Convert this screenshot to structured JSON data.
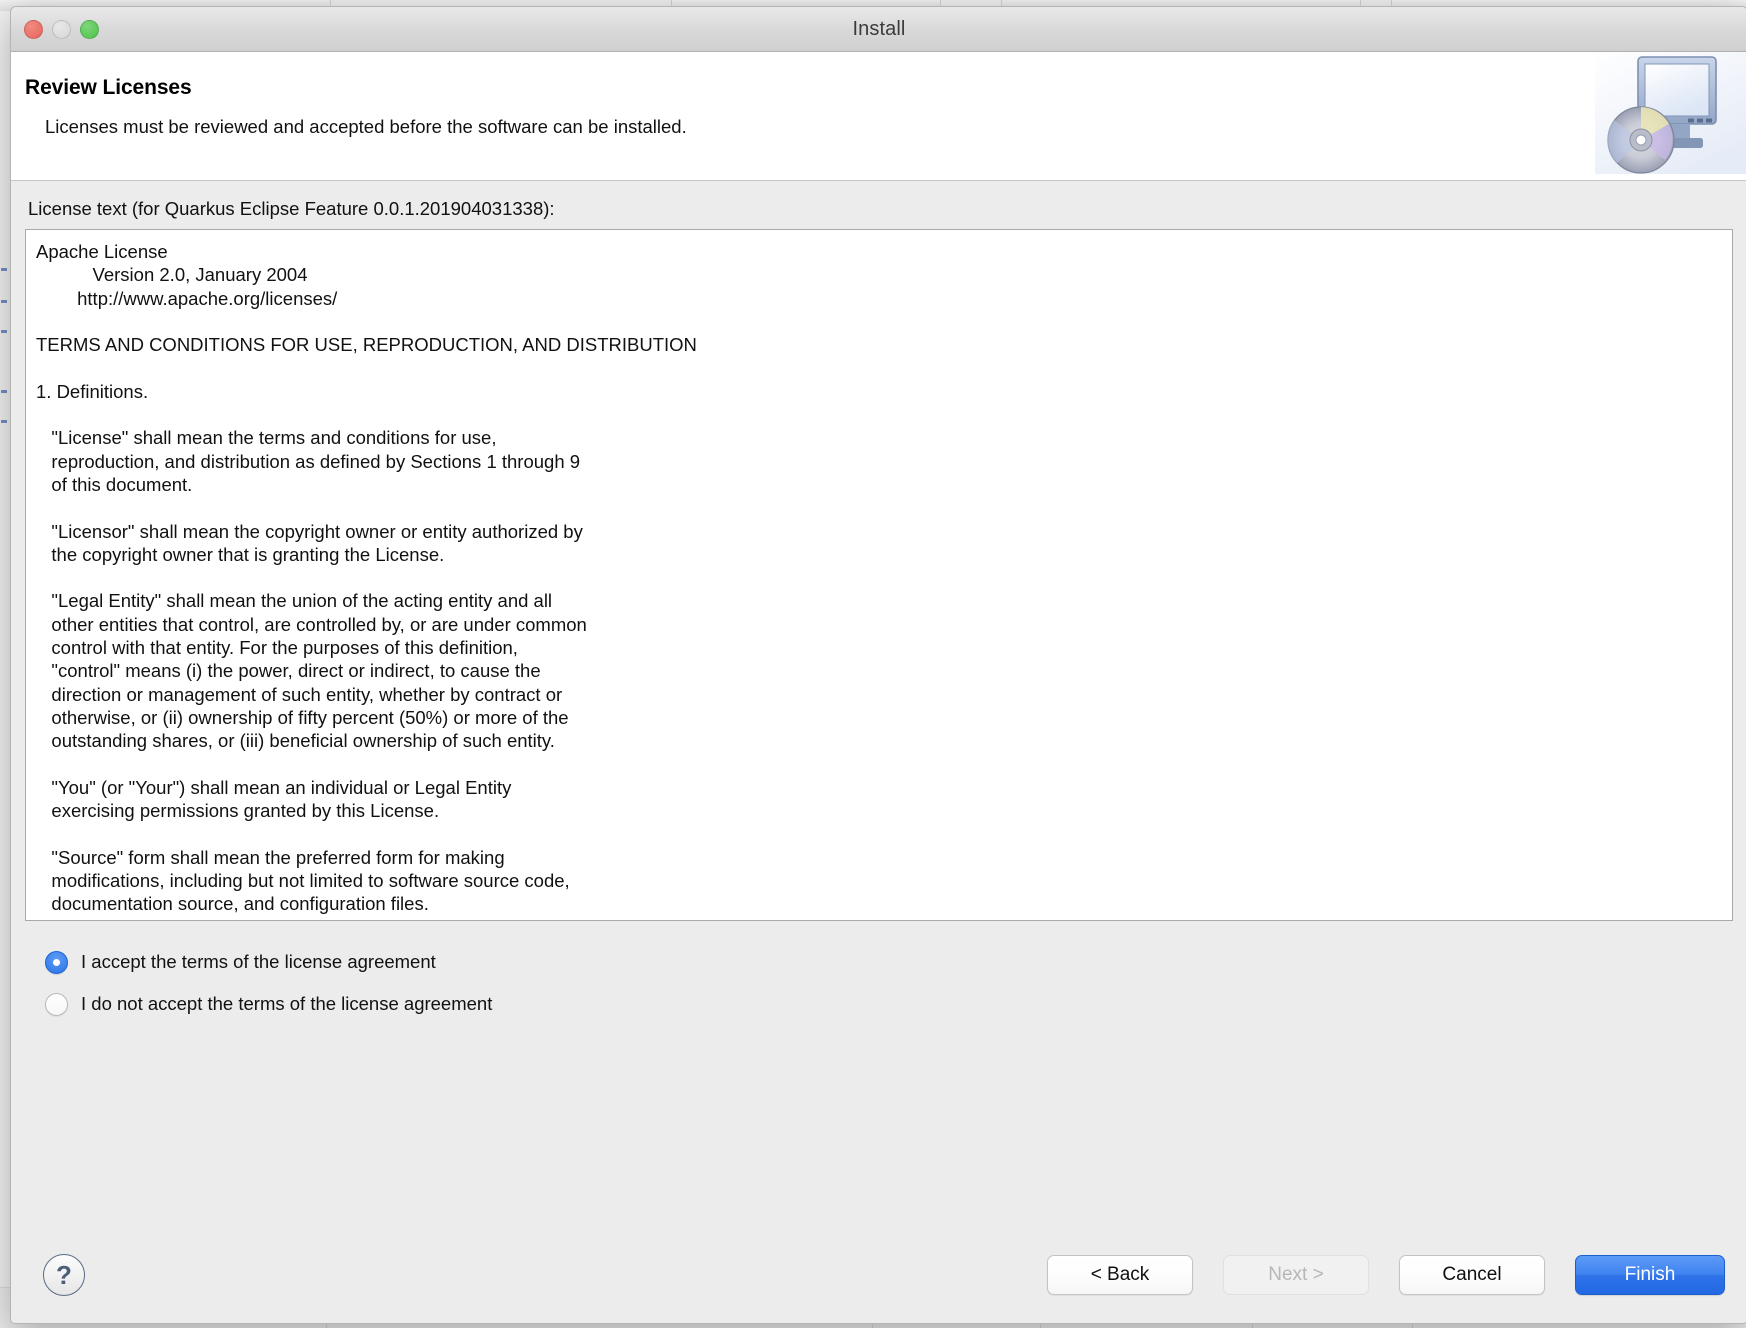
{
  "window": {
    "title": "Install",
    "traffic_lights": [
      "close",
      "minimize",
      "zoom"
    ]
  },
  "header": {
    "title": "Review Licenses",
    "subtitle": "Licenses must be reviewed and accepted before the software can be installed.",
    "icon": "install-monitor-disc-icon"
  },
  "license": {
    "label": "License text (for Quarkus Eclipse Feature 0.0.1.201904031338):",
    "text": "Apache License\n           Version 2.0, January 2004\n        http://www.apache.org/licenses/\n\nTERMS AND CONDITIONS FOR USE, REPRODUCTION, AND DISTRIBUTION\n\n1. Definitions.\n\n   \"License\" shall mean the terms and conditions for use,\n   reproduction, and distribution as defined by Sections 1 through 9\n   of this document.\n\n   \"Licensor\" shall mean the copyright owner or entity authorized by\n   the copyright owner that is granting the License.\n\n   \"Legal Entity\" shall mean the union of the acting entity and all\n   other entities that control, are controlled by, or are under common\n   control with that entity. For the purposes of this definition,\n   \"control\" means (i) the power, direct or indirect, to cause the\n   direction or management of such entity, whether by contract or\n   otherwise, or (ii) ownership of fifty percent (50%) or more of the\n   outstanding shares, or (iii) beneficial ownership of such entity.\n\n   \"You\" (or \"Your\") shall mean an individual or Legal Entity\n   exercising permissions granted by this License.\n\n   \"Source\" form shall mean the preferred form for making\n   modifications, including but not limited to software source code,\n   documentation source, and configuration files."
  },
  "agreement": {
    "accept_label": "I accept the terms of the license agreement",
    "decline_label": "I do not accept the terms of the license agreement",
    "selected": "accept"
  },
  "footer": {
    "help_label": "?",
    "back_label": "< Back",
    "next_label": "Next >",
    "cancel_label": "Cancel",
    "finish_label": "Finish",
    "next_disabled": true
  },
  "colors": {
    "accent_blue": "#2f72e8",
    "radio_blue": "#2b74e8",
    "dialog_bg": "#ececec",
    "header_bg": "#ffffff",
    "text": "#111111",
    "help_outline": "#5a6a84"
  }
}
